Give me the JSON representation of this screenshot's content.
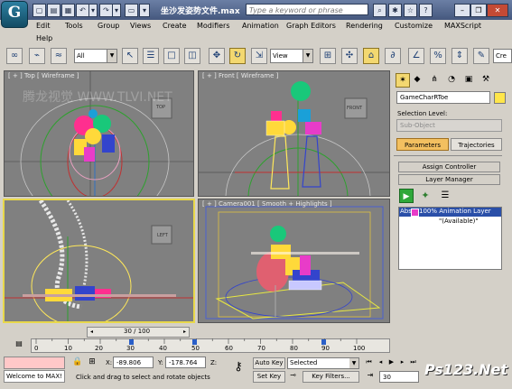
{
  "titlebar": {
    "title": "坐沙发姿势文件.max",
    "search_placeholder": "Type a keyword or phrase",
    "logo_glyph": "G"
  },
  "menu": [
    "Edit",
    "Tools",
    "Group",
    "Views",
    "Create",
    "Modifiers",
    "Animation",
    "Graph Editors",
    "Rendering",
    "Customize",
    "MAXScript",
    "Help"
  ],
  "toolbar": {
    "selection_filter": "All",
    "coord_system": "View"
  },
  "viewports": {
    "top": "[ + ] Top [ Wireframe ]",
    "front": "[ + ] Front [ Wireframe ]",
    "left_label": "LEFT",
    "camera": "[ + ] Camera001 [ Smooth + Highlights ]",
    "cube_top": "TOP",
    "cube_front": "FRONT",
    "watermark": "腾龙视觉 WWW.TLVI.NET"
  },
  "cmdpanel": {
    "object_name": "GameCharRToe",
    "selection_level_label": "Selection Level:",
    "sub_object": "Sub-Object",
    "tab_parameters": "Parameters",
    "tab_trajectories": "Trajectories",
    "rollout_assign": "Assign Controller",
    "rollout_layer": "Layer Manager",
    "layer_item": "100% Animation Layer",
    "layer_available": "\"(Available)\"",
    "layer_prefix": "Abs"
  },
  "timeline": {
    "frame_display": "30 / 100",
    "ticks": [
      "0",
      "10",
      "20",
      "30",
      "40",
      "50",
      "60",
      "70",
      "80",
      "90",
      "100"
    ]
  },
  "status": {
    "maxscript_listener": "Welcome to MAX!",
    "x_label": "X:",
    "x_value": "-89.806",
    "y_label": "Y:",
    "y_value": "-178.764",
    "z_label": "Z:",
    "prompt": "Click and drag to select and rotate objects",
    "auto_key": "Auto Key",
    "set_key": "Set Key",
    "key_mode": "Selected",
    "key_filters": "Key Filters...",
    "current_frame": "30",
    "brand_watermark": "Ps123.Net"
  }
}
